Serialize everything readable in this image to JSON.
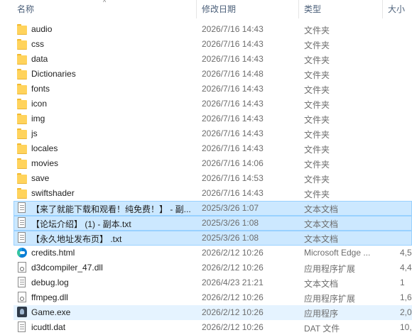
{
  "header": {
    "name_label": "名称",
    "date_label": "修改日期",
    "type_label": "类型",
    "size_label": "大小",
    "sort_indicator": "^"
  },
  "files": [
    {
      "name": "audio",
      "date": "2026/7/16 14:43",
      "type": "文件夹",
      "size": "",
      "icon": "folder-icon",
      "state": ""
    },
    {
      "name": "css",
      "date": "2026/7/16 14:43",
      "type": "文件夹",
      "size": "",
      "icon": "folder-icon",
      "state": ""
    },
    {
      "name": "data",
      "date": "2026/7/16 14:43",
      "type": "文件夹",
      "size": "",
      "icon": "folder-icon",
      "state": ""
    },
    {
      "name": "Dictionaries",
      "date": "2026/7/16 14:48",
      "type": "文件夹",
      "size": "",
      "icon": "folder-icon",
      "state": ""
    },
    {
      "name": "fonts",
      "date": "2026/7/16 14:43",
      "type": "文件夹",
      "size": "",
      "icon": "folder-icon",
      "state": ""
    },
    {
      "name": "icon",
      "date": "2026/7/16 14:43",
      "type": "文件夹",
      "size": "",
      "icon": "folder-icon",
      "state": ""
    },
    {
      "name": "img",
      "date": "2026/7/16 14:43",
      "type": "文件夹",
      "size": "",
      "icon": "folder-icon",
      "state": ""
    },
    {
      "name": "js",
      "date": "2026/7/16 14:43",
      "type": "文件夹",
      "size": "",
      "icon": "folder-icon",
      "state": ""
    },
    {
      "name": "locales",
      "date": "2026/7/16 14:43",
      "type": "文件夹",
      "size": "",
      "icon": "folder-icon",
      "state": ""
    },
    {
      "name": "movies",
      "date": "2026/7/16 14:06",
      "type": "文件夹",
      "size": "",
      "icon": "folder-icon",
      "state": ""
    },
    {
      "name": "save",
      "date": "2026/7/16 14:53",
      "type": "文件夹",
      "size": "",
      "icon": "folder-icon",
      "state": ""
    },
    {
      "name": "swiftshader",
      "date": "2026/7/16 14:43",
      "type": "文件夹",
      "size": "",
      "icon": "folder-icon",
      "state": ""
    },
    {
      "name": "【来了就能下载和观看！纯免费！】 - 副...",
      "date": "2025/3/26 1:07",
      "type": "文本文档",
      "size": "",
      "icon": "text-file-icon",
      "state": "sel"
    },
    {
      "name": "【论坛介绍】 (1) - 副本.txt",
      "date": "2025/3/26 1:08",
      "type": "文本文档",
      "size": "",
      "icon": "text-file-icon",
      "state": "sel"
    },
    {
      "name": "【永久地址发布页】 .txt",
      "date": "2025/3/26 1:08",
      "type": "文本文档",
      "size": "",
      "icon": "text-file-icon",
      "state": "sel"
    },
    {
      "name": "credits.html",
      "date": "2026/2/12 10:26",
      "type": "Microsoft Edge ...",
      "size": "4,5",
      "icon": "edge-html-icon",
      "state": ""
    },
    {
      "name": "d3dcompiler_47.dll",
      "date": "2026/2/12 10:26",
      "type": "应用程序扩展",
      "size": "4,4",
      "icon": "dll-file-icon",
      "state": ""
    },
    {
      "name": "debug.log",
      "date": "2026/4/23 21:21",
      "type": "文本文档",
      "size": "1",
      "icon": "text-file-icon",
      "state": ""
    },
    {
      "name": "ffmpeg.dll",
      "date": "2026/2/12 10:26",
      "type": "应用程序扩展",
      "size": "1,6",
      "icon": "dll-file-icon",
      "state": ""
    },
    {
      "name": "Game.exe",
      "date": "2026/2/12 10:26",
      "type": "应用程序",
      "size": "2,0",
      "icon": "game-exe-icon",
      "state": "hover"
    },
    {
      "name": "icudtl.dat",
      "date": "2026/2/12 10:26",
      "type": "DAT 文件",
      "size": "10,2",
      "icon": "dat-file-icon",
      "state": ""
    }
  ]
}
